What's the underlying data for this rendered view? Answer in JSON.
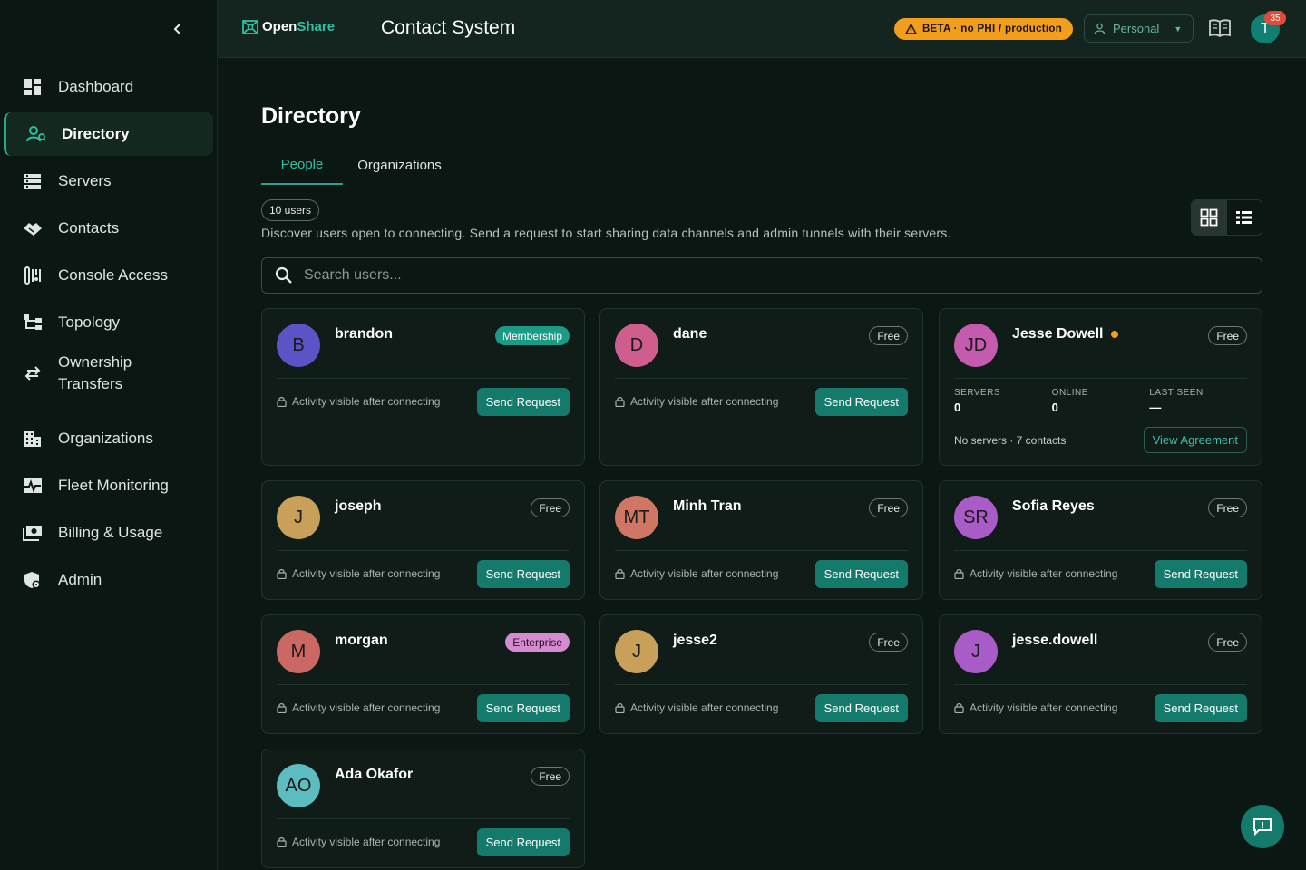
{
  "sidebar": {
    "items": [
      {
        "label": "Dashboard",
        "icon": "dashboard-icon"
      },
      {
        "label": "Directory",
        "icon": "directory-icon",
        "active": true
      },
      {
        "label": "Servers",
        "icon": "servers-icon"
      },
      {
        "label": "Contacts",
        "icon": "handshake-icon"
      },
      {
        "label": "Console Access",
        "icon": "console-icon"
      },
      {
        "label": "Topology",
        "icon": "topology-icon"
      },
      {
        "label": "Ownership Transfers",
        "icon": "transfer-icon"
      },
      {
        "label": "Organizations",
        "icon": "building-icon"
      },
      {
        "label": "Fleet Monitoring",
        "icon": "monitoring-icon"
      },
      {
        "label": "Billing & Usage",
        "icon": "billing-icon"
      },
      {
        "label": "Admin",
        "icon": "admin-shield-icon"
      }
    ]
  },
  "header": {
    "logo_open": "Open",
    "logo_share": "Share",
    "app_title": "Contact System",
    "beta_label": "BETA · no PHI / production",
    "workspace": "Personal",
    "avatar_initial": "T",
    "notification_count": "35"
  },
  "main": {
    "title": "Directory",
    "tabs": [
      {
        "label": "People",
        "active": true
      },
      {
        "label": "Organizations"
      }
    ],
    "user_count": "10 users",
    "subtitle": "Discover users open to connecting. Send a request to start sharing data channels and admin tunnels with their servers.",
    "search_placeholder": "Search users..."
  },
  "common": {
    "activity_text": "Activity visible after connecting",
    "send_label": "Send Request"
  },
  "cards": [
    {
      "initials": "B",
      "name": "brandon",
      "plan": "Membership",
      "color": "#5a54c7"
    },
    {
      "initials": "D",
      "name": "dane",
      "plan": "Free",
      "color": "#cf5d8d"
    },
    {
      "initials": "JD",
      "name": "Jesse Dowell",
      "plan": "Free",
      "color": "#c45bae",
      "online": true,
      "stats": [
        {
          "label": "SERVERS",
          "value": "0"
        },
        {
          "label": "ONLINE",
          "value": "0"
        },
        {
          "label": "LAST SEEN",
          "value": "—"
        }
      ],
      "meta": "No servers · 7 contacts",
      "agreement": "View Agreement"
    },
    {
      "initials": "J",
      "name": "joseph",
      "plan": "Free",
      "color": "#c9a05a"
    },
    {
      "initials": "MT",
      "name": "Minh Tran",
      "plan": "Free",
      "color": "#cf7665"
    },
    {
      "initials": "SR",
      "name": "Sofia Reyes",
      "plan": "Free",
      "color": "#a95bc8"
    },
    {
      "initials": "M",
      "name": "morgan",
      "plan": "Enterprise",
      "color": "#cc6863"
    },
    {
      "initials": "J",
      "name": "jesse2",
      "plan": "Free",
      "color": "#c9a05a"
    },
    {
      "initials": "J",
      "name": "jesse.dowell",
      "plan": "Free",
      "color": "#a95bc8"
    },
    {
      "initials": "AO",
      "name": "Ada Okafor",
      "plan": "Free",
      "color": "#5cbcc0"
    }
  ]
}
